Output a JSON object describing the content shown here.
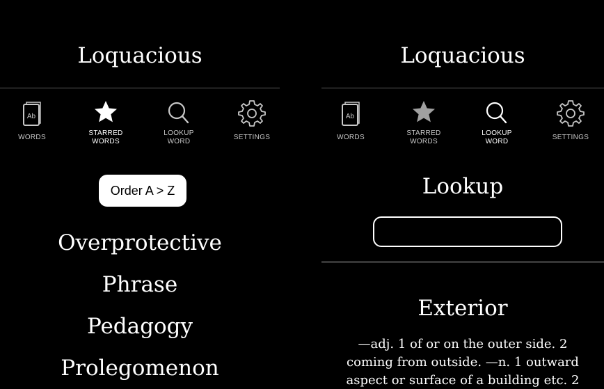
{
  "left_screen": {
    "app_title": "Loquacious",
    "tabs": [
      {
        "label": "WORDS",
        "icon": "book-icon"
      },
      {
        "label": "STARRED\nWORDS",
        "icon": "star-icon"
      },
      {
        "label": "LOOKUP\nWORD",
        "icon": "search-icon"
      },
      {
        "label": "SETTINGS",
        "icon": "gear-icon"
      }
    ],
    "active_tab": "STARRED\nWORDS",
    "order_button_label": "Order A > Z",
    "words": [
      "Overprotective",
      "Phrase",
      "Pedagogy",
      "Prolegomenon"
    ]
  },
  "right_screen": {
    "app_title": "Loquacious",
    "tabs": [
      {
        "label": "WORDS",
        "icon": "book-icon"
      },
      {
        "label": "STARRED\nWORDS",
        "icon": "star-icon"
      },
      {
        "label": "LOOKUP\nWORD",
        "icon": "search-icon"
      },
      {
        "label": "SETTINGS",
        "icon": "gear-icon"
      }
    ],
    "active_tab": "LOOKUP\nWORD",
    "lookup_heading": "Lookup",
    "lookup_input_value": "",
    "result_word": "Exterior",
    "definition": "—adj. 1 of or on the outer side. 2 coming from outside. —n. 1 outward aspect or surface of a building etc. 2"
  },
  "colors": {
    "background": "#000000",
    "text": "#ffffff",
    "inactive_tab": "#c8c8c8",
    "divider": "#5a5a5a"
  }
}
